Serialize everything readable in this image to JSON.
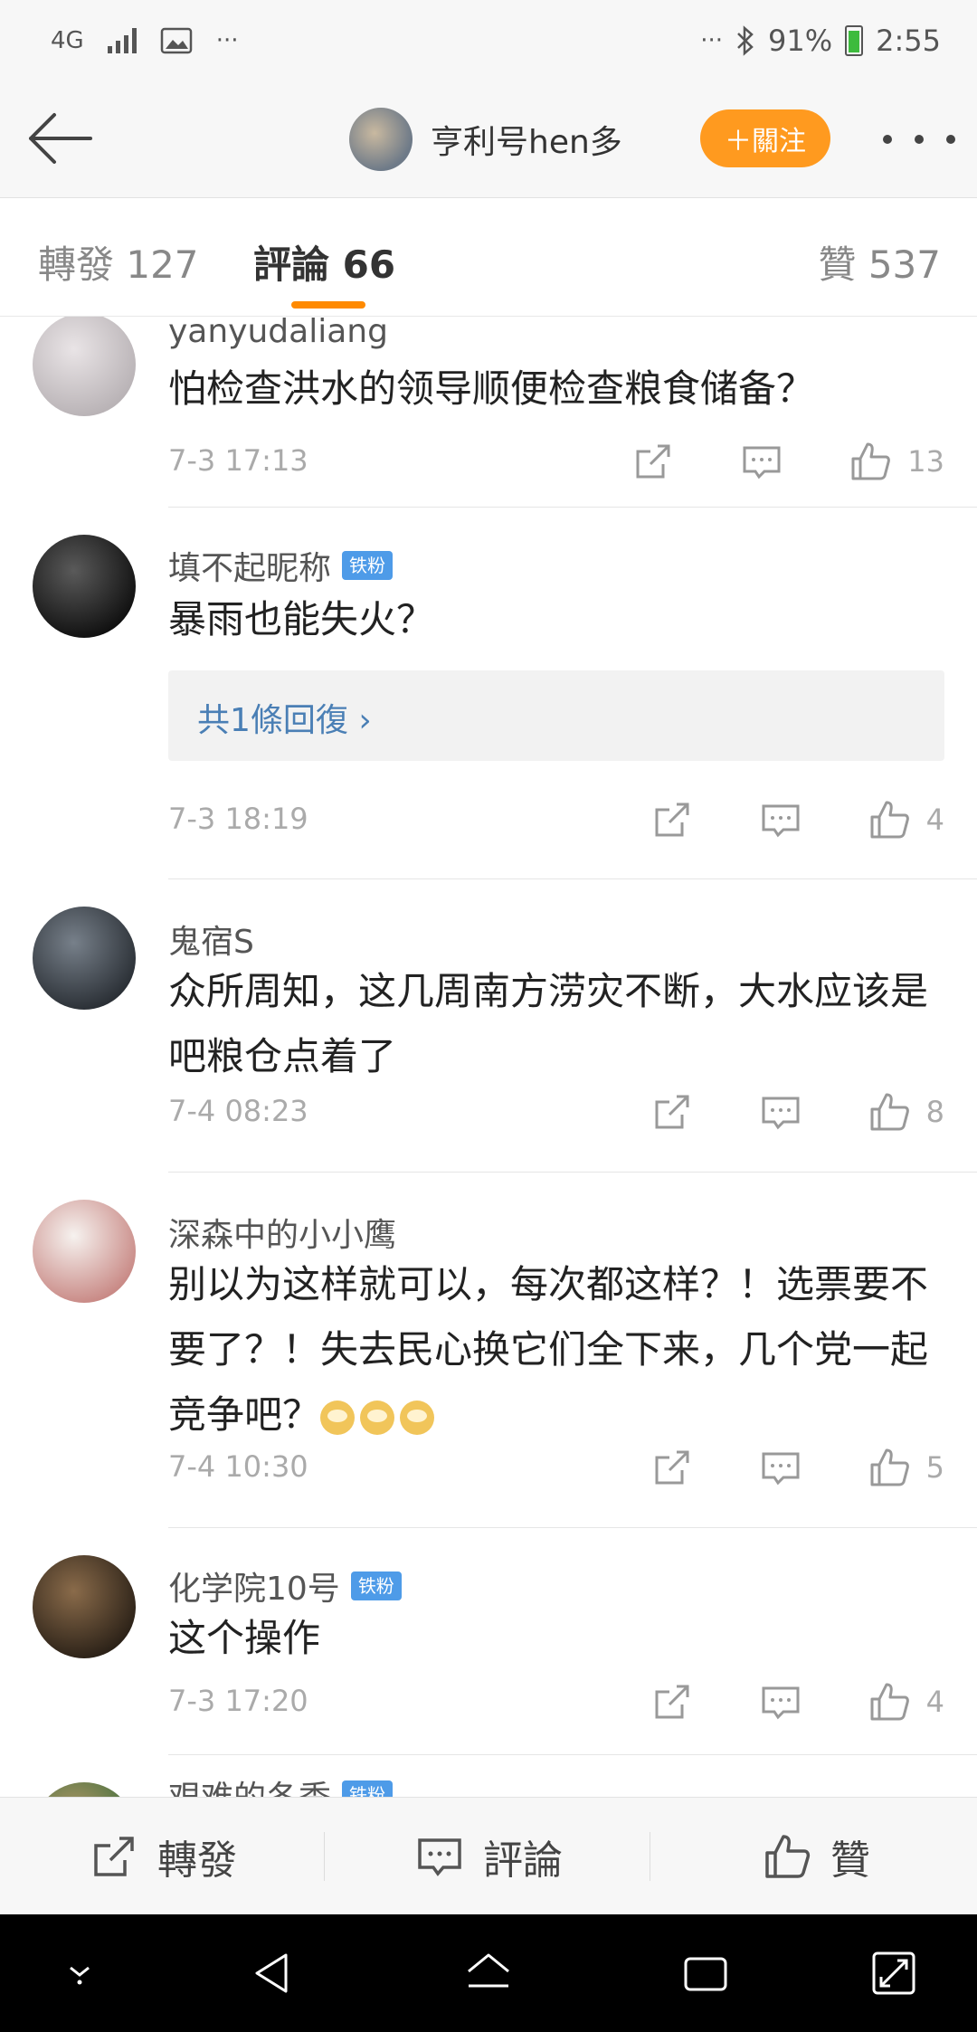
{
  "status_bar": {
    "network": "4G",
    "more": "···",
    "right_more": "···",
    "battery": "91%",
    "time": "2:55"
  },
  "header": {
    "username": "亨利号hen多",
    "follow_label": "＋關注"
  },
  "tabs": {
    "repost": "轉發 127",
    "comment": "評論 66",
    "like": "贊 537"
  },
  "comments": [
    {
      "username": "yanyudaliang",
      "badge": "",
      "text": "怕检查洪水的领导顺便检查粮食储备？",
      "time": "7-3 17:13",
      "likes": "13",
      "avatar_colors": [
        "#e9e4e6",
        "#b9b3b6"
      ]
    },
    {
      "username": "填不起昵称",
      "badge": "铁粉",
      "text": "暴雨也能失火？",
      "reply_label": "共1條回復 ›",
      "time": "7-3 18:19",
      "likes": "4",
      "avatar_colors": [
        "#5a5a5a",
        "#111111"
      ]
    },
    {
      "username": "鬼宿S",
      "badge": "",
      "text": "众所周知，这几周南方涝灾不断，大水应该是吧粮仓点着了",
      "time": "7-4 08:23",
      "likes": "8",
      "avatar_colors": [
        "#77808a",
        "#2b3036"
      ]
    },
    {
      "username": "深森中的小小鹰",
      "badge": "",
      "text": "别以为这样就可以，每次都这样？！选票要不要了？！失去民心换它们全下来，几个党一起竞争吧？",
      "emoji_count": "3",
      "time": "7-4 10:30",
      "likes": "5",
      "avatar_colors": [
        "#f6f2ef",
        "#c98a86"
      ]
    },
    {
      "username": "化学院10号",
      "badge": "铁粉",
      "text": "这个操作",
      "time": "7-3 17:20",
      "likes": "4",
      "avatar_colors": [
        "#8a6b4a",
        "#2c2218"
      ]
    },
    {
      "username": "艰难的冬季",
      "badge": "铁粉",
      "avatar_colors": [
        "#b89a6a",
        "#3c6d3a"
      ]
    }
  ],
  "bottom_bar": {
    "repost": "轉發",
    "comment": "評論",
    "like": "贊"
  }
}
